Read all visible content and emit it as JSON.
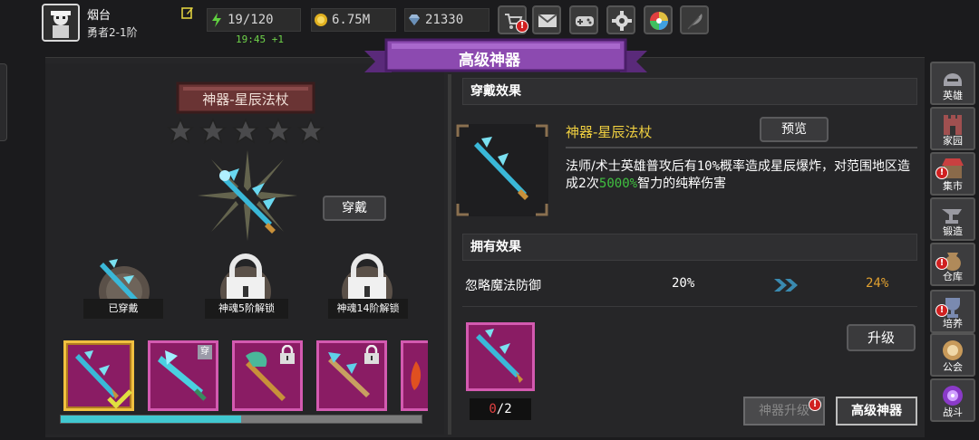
{
  "player": {
    "name": "烟台",
    "rank": "勇者2-1阶"
  },
  "resources": {
    "stamina": "19/120",
    "stamina_timer": "19:45 +1",
    "gold": "6.75M",
    "gems": "21330"
  },
  "banner": {
    "title": "高级神器"
  },
  "artifact": {
    "plate_name": "神器-星辰法杖",
    "stars_total": 5,
    "stars_filled": 0,
    "equip_label": "穿戴",
    "slots": [
      {
        "label": "已穿戴"
      },
      {
        "label": "神魂5阶解锁"
      },
      {
        "label": "神魂14阶解锁"
      }
    ],
    "inventory_worn_badge": "穿",
    "scroll_progress": 0.5
  },
  "wear_effect": {
    "header": "穿戴效果",
    "name": "神器-星辰法杖",
    "preview_label": "预览",
    "desc_part1": "法师/术士英雄普攻后有",
    "desc_pct1": "10%",
    "desc_part2": "概率造成星辰爆炸，对范围地区造成2次",
    "desc_pct2": "5000%",
    "desc_part3": "智力的纯粹伤害"
  },
  "own_effect": {
    "header": "拥有效果",
    "stat_name": "忽略魔法防御",
    "current": "20%",
    "next": "24%"
  },
  "upgrade": {
    "material_have": "0",
    "material_need": "/2",
    "upgrade_label": "升级",
    "rise_label": "神器升级",
    "advanced_label": "高级神器",
    "alert_mark": "!"
  },
  "sidebar": [
    {
      "label": "英雄"
    },
    {
      "label": "家园"
    },
    {
      "label": "集市"
    },
    {
      "label": "锻造"
    },
    {
      "label": "仓库"
    },
    {
      "label": "培养"
    },
    {
      "label": "公会"
    },
    {
      "label": "战斗"
    }
  ],
  "colors": {
    "accent_purple": "#7a3a9a",
    "rarity_border": "#d35ab0",
    "highlight_gold": "#f0d040",
    "bonus_green": "#40c040"
  }
}
